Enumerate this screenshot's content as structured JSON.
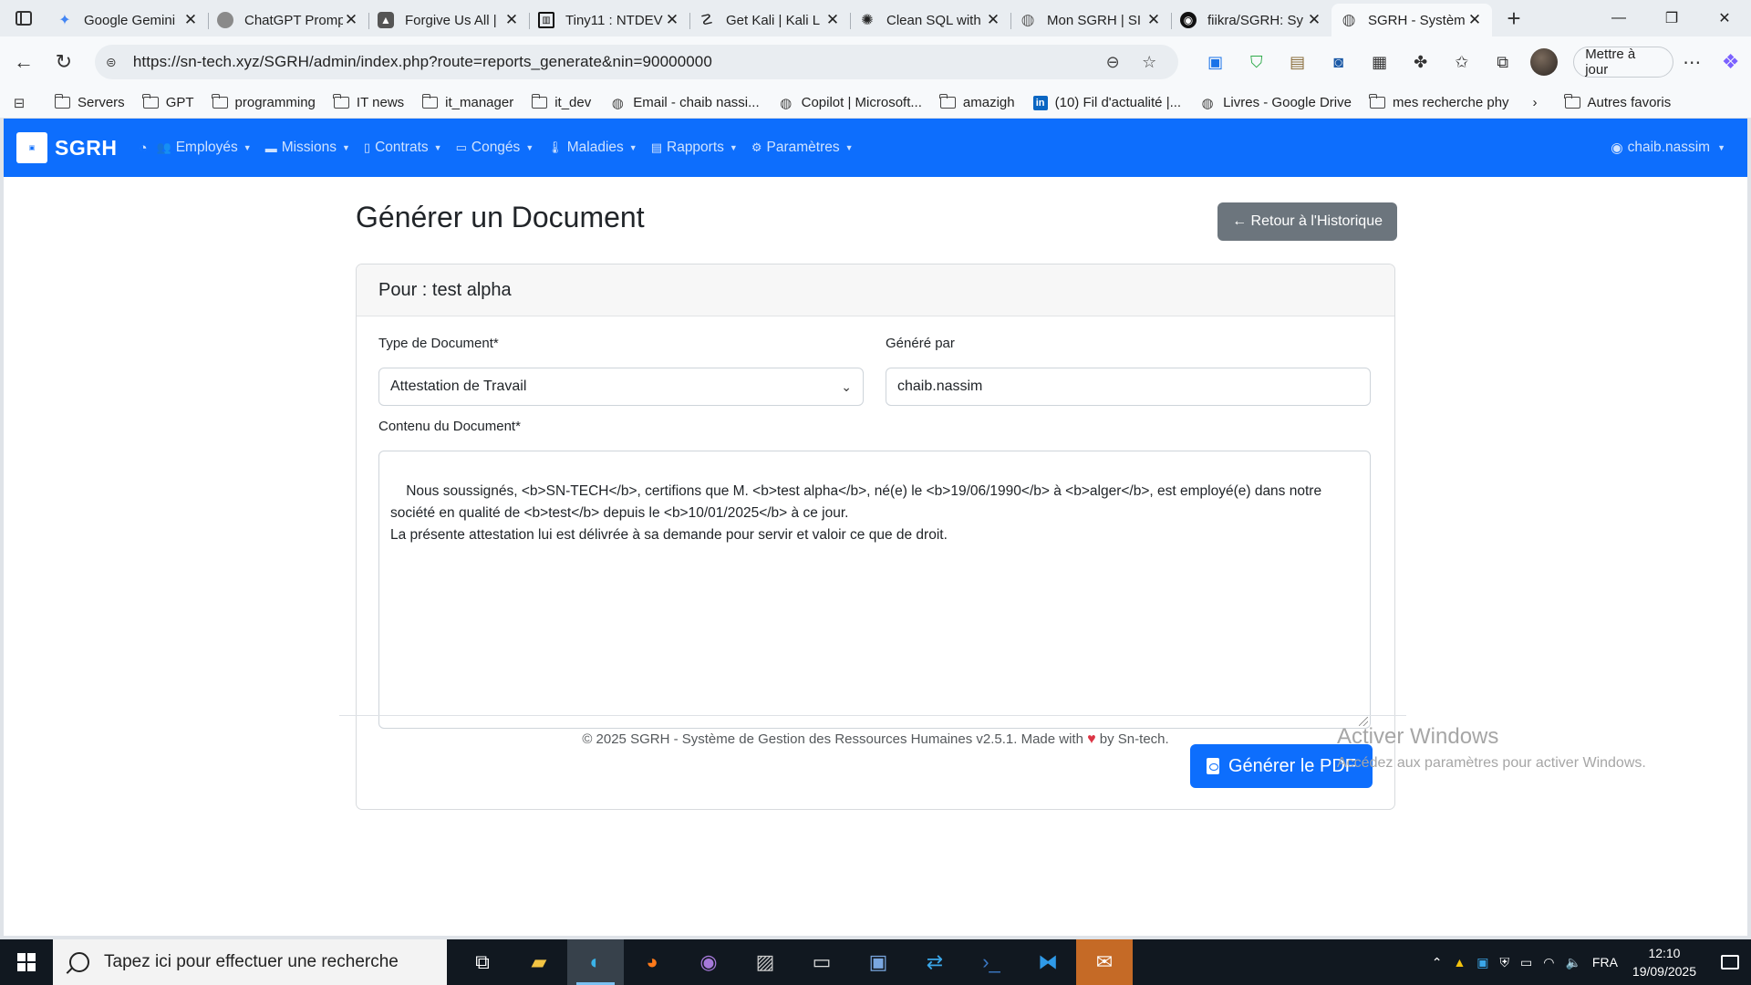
{
  "browser": {
    "tabs": [
      {
        "title": "Google Gemini",
        "icon": "gemini-icon",
        "color": "#4285f4"
      },
      {
        "title": "ChatGPT Promp",
        "icon": "chatgpt-icon",
        "color": "#777777"
      },
      {
        "title": "Forgive Us All |",
        "icon": "drive-icon",
        "color": "#555555"
      },
      {
        "title": "Tiny11 : NTDEV",
        "icon": "archive-icon",
        "color": "#111111"
      },
      {
        "title": "Get Kali | Kali L",
        "icon": "kali-icon",
        "color": "#222222"
      },
      {
        "title": "Clean SQL with",
        "icon": "openai-icon",
        "color": "#222222"
      },
      {
        "title": "Mon SGRH | SI",
        "icon": "globe-icon",
        "color": "#666666"
      },
      {
        "title": "fiikra/SGRH: Sy",
        "icon": "github-icon",
        "color": "#111111"
      },
      {
        "title": "SGRH - Systèm",
        "icon": "globe-icon",
        "color": "#555555"
      }
    ],
    "new_tab": "+",
    "url": "https://sn-tech.xyz/SGRH/admin/index.php?route=reports_generate&nin=90000000",
    "update_label": "Mettre à jour",
    "bookmarks": [
      {
        "label": "Servers",
        "type": "folder"
      },
      {
        "label": "GPT",
        "type": "folder"
      },
      {
        "label": "programming",
        "type": "folder"
      },
      {
        "label": "IT news",
        "type": "folder"
      },
      {
        "label": "it_manager",
        "type": "folder"
      },
      {
        "label": "it_dev",
        "type": "folder"
      },
      {
        "label": "Email - chaib nassi...",
        "type": "globe"
      },
      {
        "label": "Copilot | Microsoft...",
        "type": "globe"
      },
      {
        "label": "amazigh",
        "type": "folder"
      },
      {
        "label": "(10) Fil d'actualité |...",
        "type": "linkedin"
      },
      {
        "label": "Livres - Google Drive",
        "type": "globe"
      },
      {
        "label": "mes recherche phy",
        "type": "folder"
      }
    ],
    "other_bookmarks": "Autres favoris"
  },
  "app": {
    "brand": "SGRH",
    "menu": [
      {
        "label": "Employés",
        "icon": "users-icon"
      },
      {
        "label": "Missions",
        "icon": "briefcase-icon"
      },
      {
        "label": "Contrats",
        "icon": "file-icon"
      },
      {
        "label": "Congés",
        "icon": "calendar-icon"
      },
      {
        "label": "Maladies",
        "icon": "thermometer-icon"
      },
      {
        "label": "Rapports",
        "icon": "report-icon"
      },
      {
        "label": "Paramètres",
        "icon": "gear-icon"
      }
    ],
    "user": "chaib.nassim"
  },
  "page": {
    "title": "Générer un Document",
    "back_label": "← Retour à l'Historique",
    "card_header": "Pour : test alpha",
    "doc_type_label": "Type de Document*",
    "doc_type_value": "Attestation de Travail",
    "generated_by_label": "Généré par",
    "generated_by_value": "chaib.nassim",
    "content_label": "Contenu du Document*",
    "content_value": "Nous soussignés, <b>SN-TECH</b>, certifions que M. <b>test alpha</b>, né(e) le <b>19/06/1990</b> à <b>alger</b>, est employé(e) dans notre société en qualité de <b>test</b> depuis le <b>10/01/2025</b> à ce jour.\nLa présente attestation lui est délivrée à sa demande pour servir et valoir ce que de droit.",
    "generate_label": "Générer le PDF"
  },
  "footer": {
    "text_before": "© 2025 SGRH - Système de Gestion des Ressources Humaines v2.5.1. Made with",
    "text_after": "by Sn-tech."
  },
  "watermark": {
    "line1": "Activer Windows",
    "line2": "Accédez aux paramètres pour activer Windows."
  },
  "taskbar": {
    "search_placeholder": "Tapez ici pour effectuer une recherche",
    "language": "FRA",
    "time": "12:10",
    "date": "19/09/2025"
  }
}
